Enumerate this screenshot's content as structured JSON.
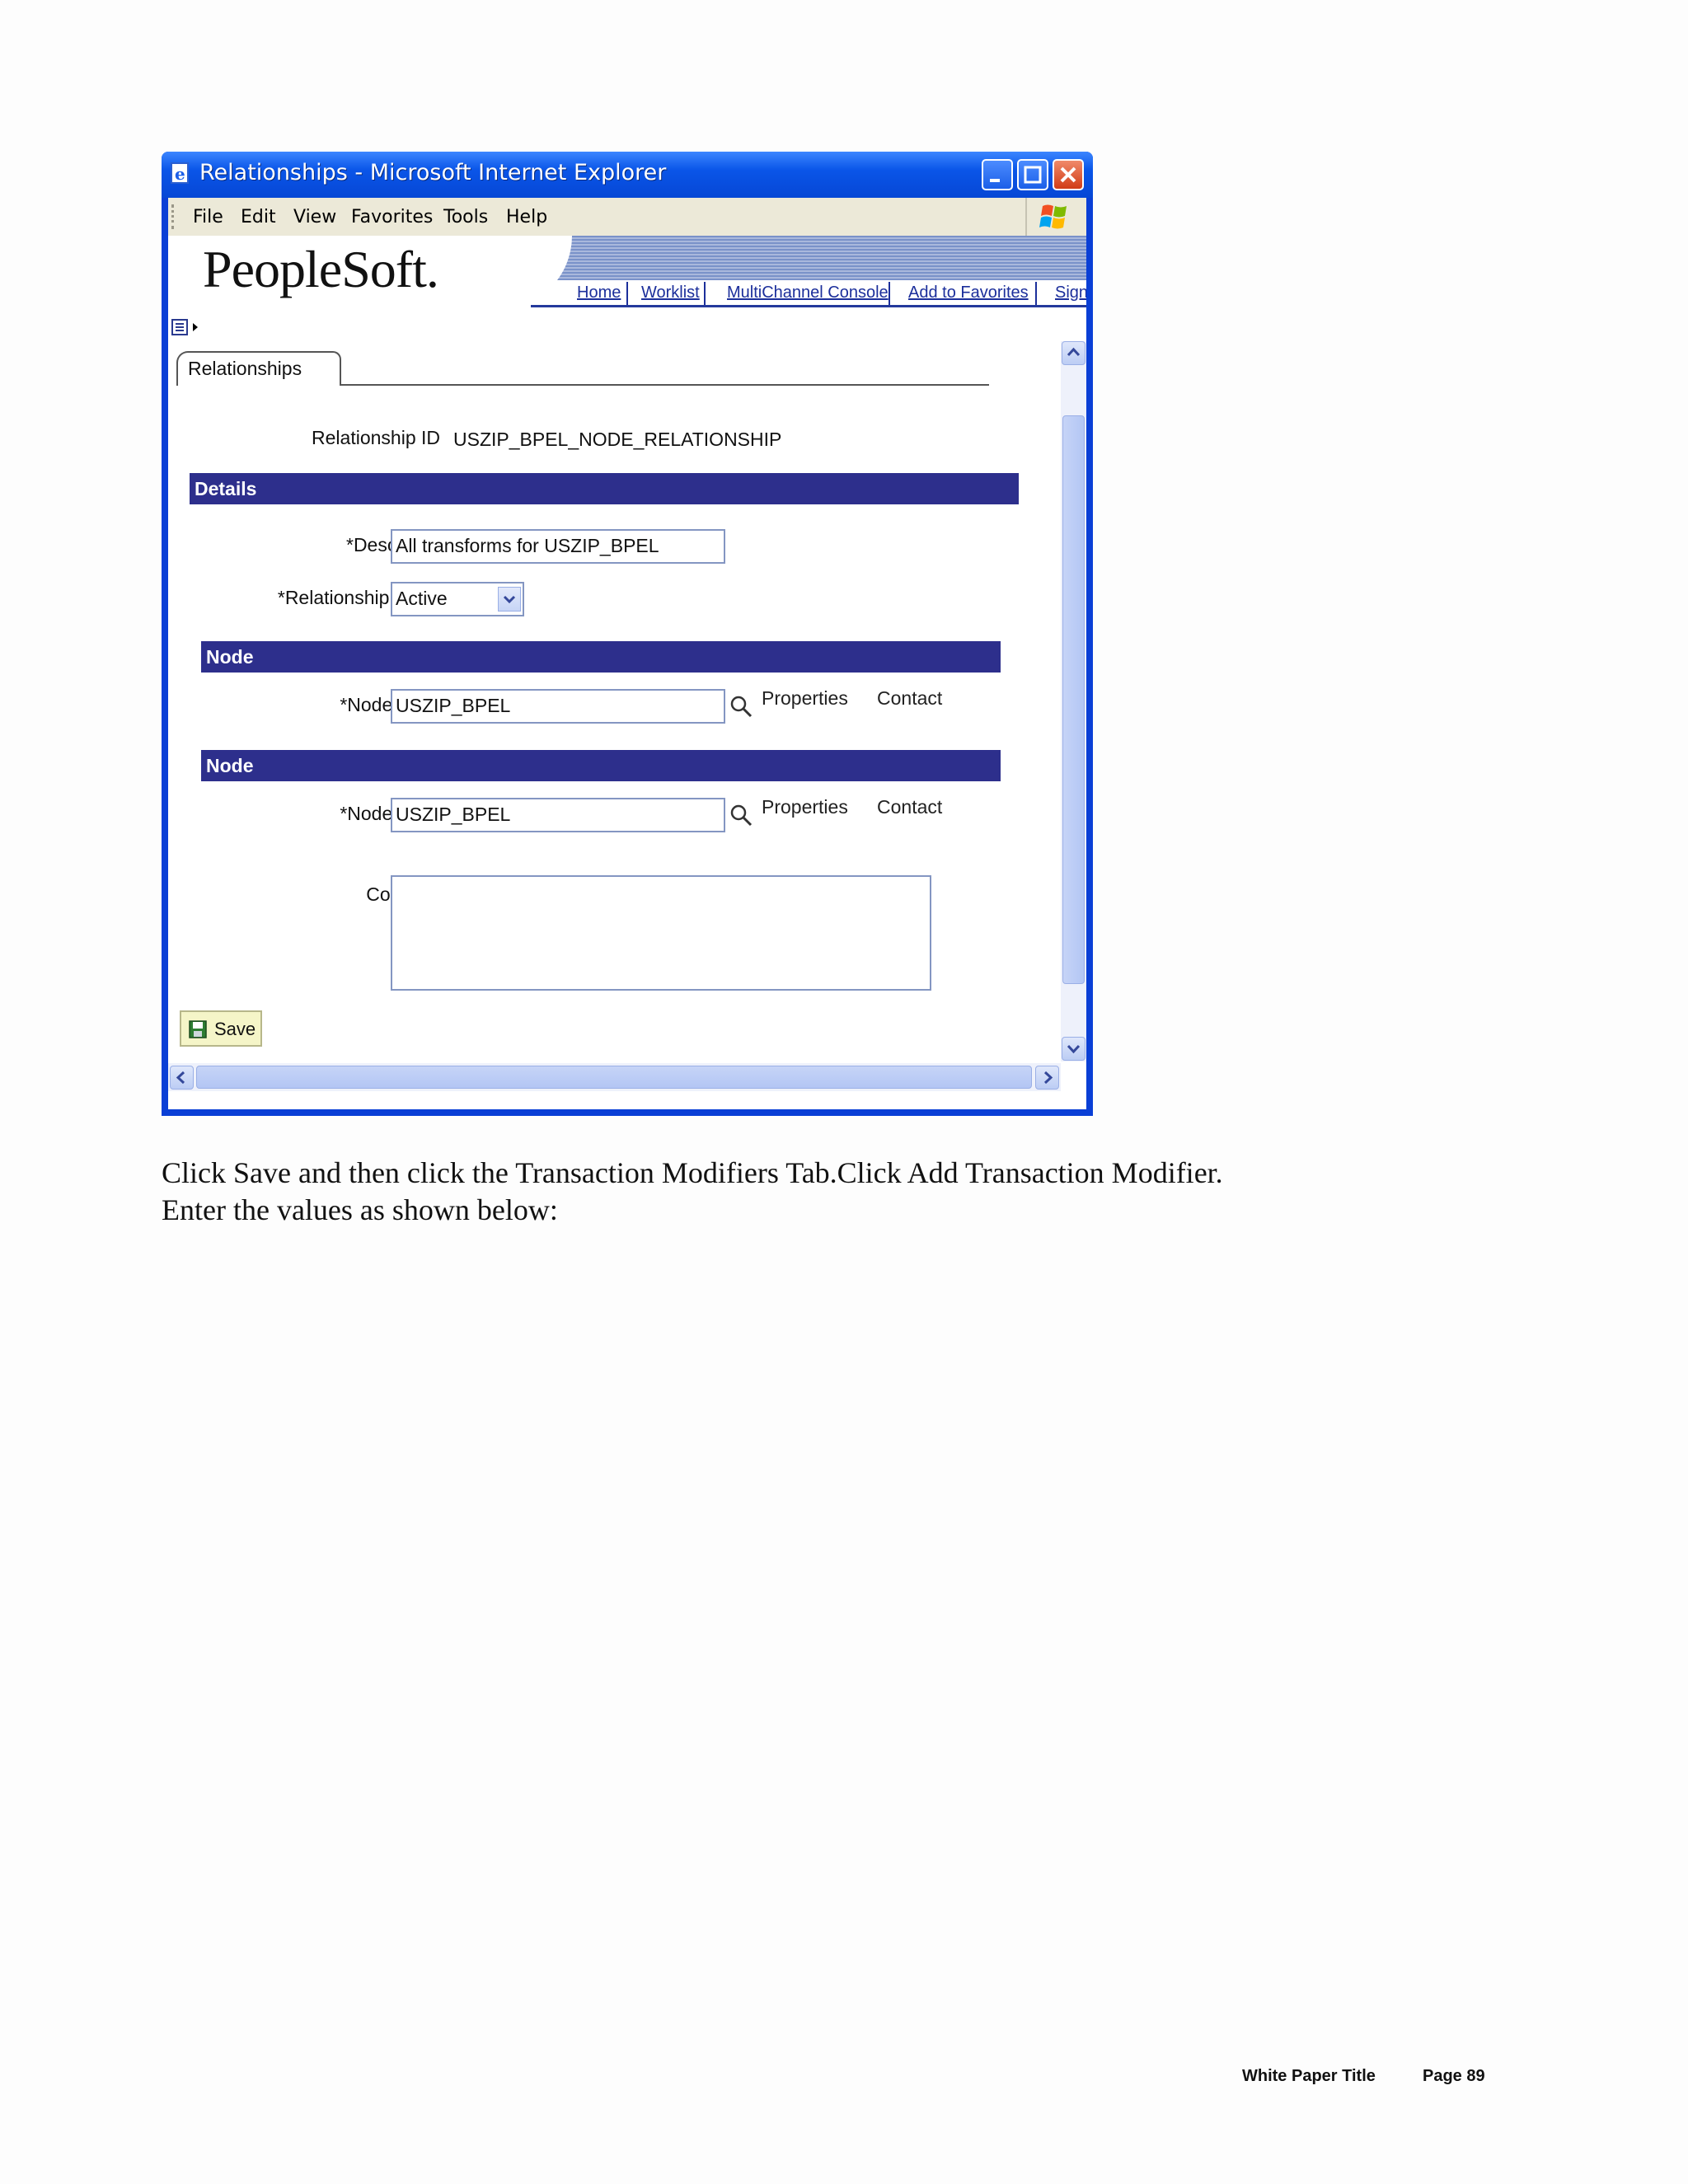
{
  "window": {
    "title": "Relationships - Microsoft Internet Explorer",
    "menu": [
      "File",
      "Edit",
      "View",
      "Favorites",
      "Tools",
      "Help"
    ]
  },
  "header": {
    "logo": "PeopleSoft.",
    "nav_links": [
      "Home",
      "Worklist",
      "MultiChannel Console",
      "Add to Favorites",
      "Sign"
    ]
  },
  "page": {
    "tab": "Relationships",
    "relationship_id_label": "Relationship ID",
    "relationship_id_value": "USZIP_BPEL_NODE_RELATIONSHIP",
    "details_header": "Details",
    "description_label": "*Description",
    "description_value": "All transforms for USZIP_BPEL",
    "status_label": "*Relationship Status",
    "status_value": "Active",
    "nodes": [
      {
        "header": "Node",
        "name_label": "*Node Name",
        "name_value": "USZIP_BPEL",
        "properties": "Properties",
        "contact": "Contact"
      },
      {
        "header": "Node",
        "name_label": "*Node Name",
        "name_value": "USZIP_BPEL",
        "properties": "Properties",
        "contact": "Contact"
      }
    ],
    "comment_label": "Comment",
    "comment_value": "",
    "save_label": "Save"
  },
  "document": {
    "line1": "Click Save and then click the Transaction Modifiers Tab.Click Add Transaction Modifier.",
    "line2": "Enter the values as shown below:",
    "footer_title": "White Paper Title",
    "footer_page": "Page 89"
  },
  "colors": {
    "titlebar": "#0a55e8",
    "section_bar": "#2d2f8c",
    "nav_link": "#1c2f9b",
    "save_button_bg": "#f5f5c8"
  }
}
